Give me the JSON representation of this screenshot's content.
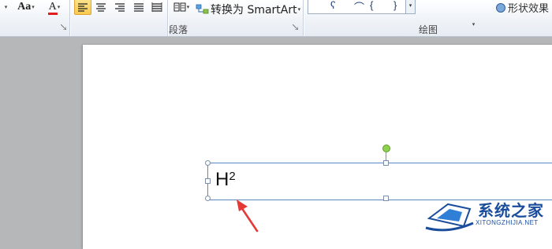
{
  "ribbon": {
    "font_group": {
      "grow_font_label": "Aa",
      "font_color_letter": "A"
    },
    "paragraph_group": {
      "label": "段落",
      "smartart_label": "转换为 SmartArt"
    },
    "drawing_group": {
      "label": "绘图",
      "shape_effects_label": "形状效果"
    }
  },
  "document": {
    "textbox": {
      "base": "H",
      "superscript": "2"
    }
  },
  "watermark": {
    "title": "系统之家",
    "url": "XITONGZHIJIA.NET"
  },
  "colors": {
    "arrow": "#e53935",
    "selection": "#5b87c5",
    "rotation_handle": "#8fd14f",
    "watermark": "#1a4d9c"
  }
}
